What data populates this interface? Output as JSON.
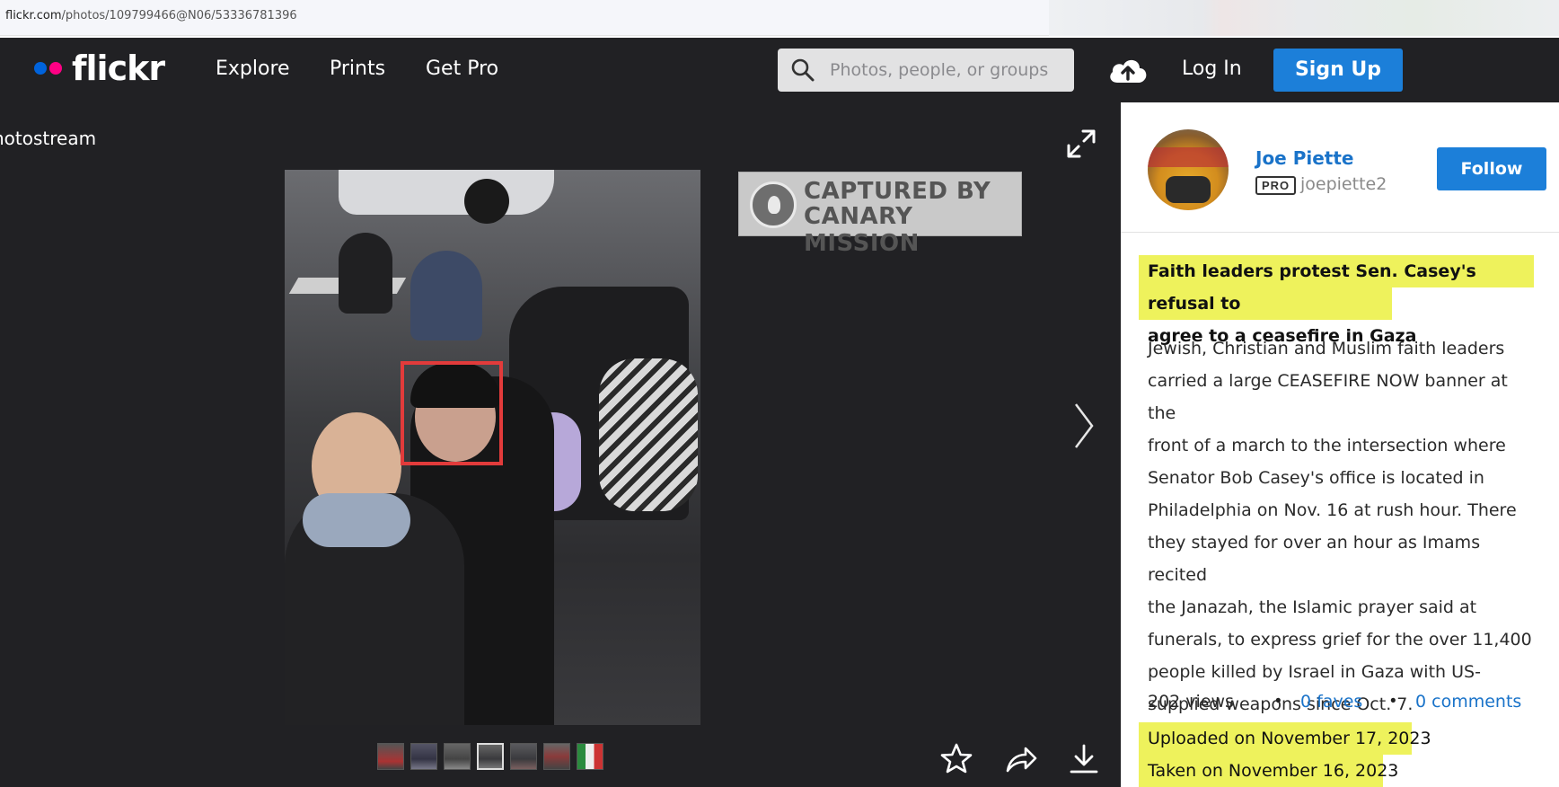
{
  "browser": {
    "url_host": "flickr.com",
    "url_path": "/photos/109799466@N06/53336781396"
  },
  "header": {
    "logo_text": "flickr",
    "nav": [
      "Explore",
      "Prints",
      "Get Pro"
    ],
    "search_placeholder": "Photos, people, or groups",
    "login_label": "Log In",
    "signup_label": "Sign Up"
  },
  "viewer": {
    "back_label": "hotostream",
    "stamp_line1": "CAPTURED BY",
    "stamp_line2": "CANARY MISSION",
    "thumbnail_count": 7
  },
  "sidebar": {
    "owner_name": "Joe Piette",
    "pro_badge": "PRO",
    "owner_handle": "joepiette2",
    "follow_label": "Follow",
    "title_line1": "Faith leaders protest Sen. Casey's refusal to",
    "title_line2": "agree to a ceasefire in Gaza",
    "description": [
      "Jewish, Christian and Muslim faith leaders",
      "carried a large CEASEFIRE NOW banner at the",
      "front of a march to the intersection where",
      "Senator Bob Casey's office is located in",
      "Philadelphia on Nov. 16 at rush hour. There",
      "they stayed for over an hour as Imams recited",
      "the Janazah, the Islamic prayer said at",
      "funerals, to express grief for the over 11,400",
      "people killed by Israel in Gaza with US-",
      "supplied weapons since Oct. 7."
    ],
    "views": "202 views",
    "faves": "0 faves",
    "comments": "0 comments",
    "uploaded": "Uploaded on November 17, 2023",
    "taken": "Taken on November 16, 2023"
  },
  "colors": {
    "brand_blue": "#1c7fd9",
    "brand_pink": "#ff0084",
    "brand_dot_blue": "#0063dc",
    "highlight": "#eef25c",
    "annotation_red": "#e23b3b"
  },
  "icons": [
    "search-icon",
    "upload-cloud-icon",
    "expand-icon",
    "next-arrow-icon",
    "favorite-star-icon",
    "share-icon",
    "download-icon"
  ]
}
